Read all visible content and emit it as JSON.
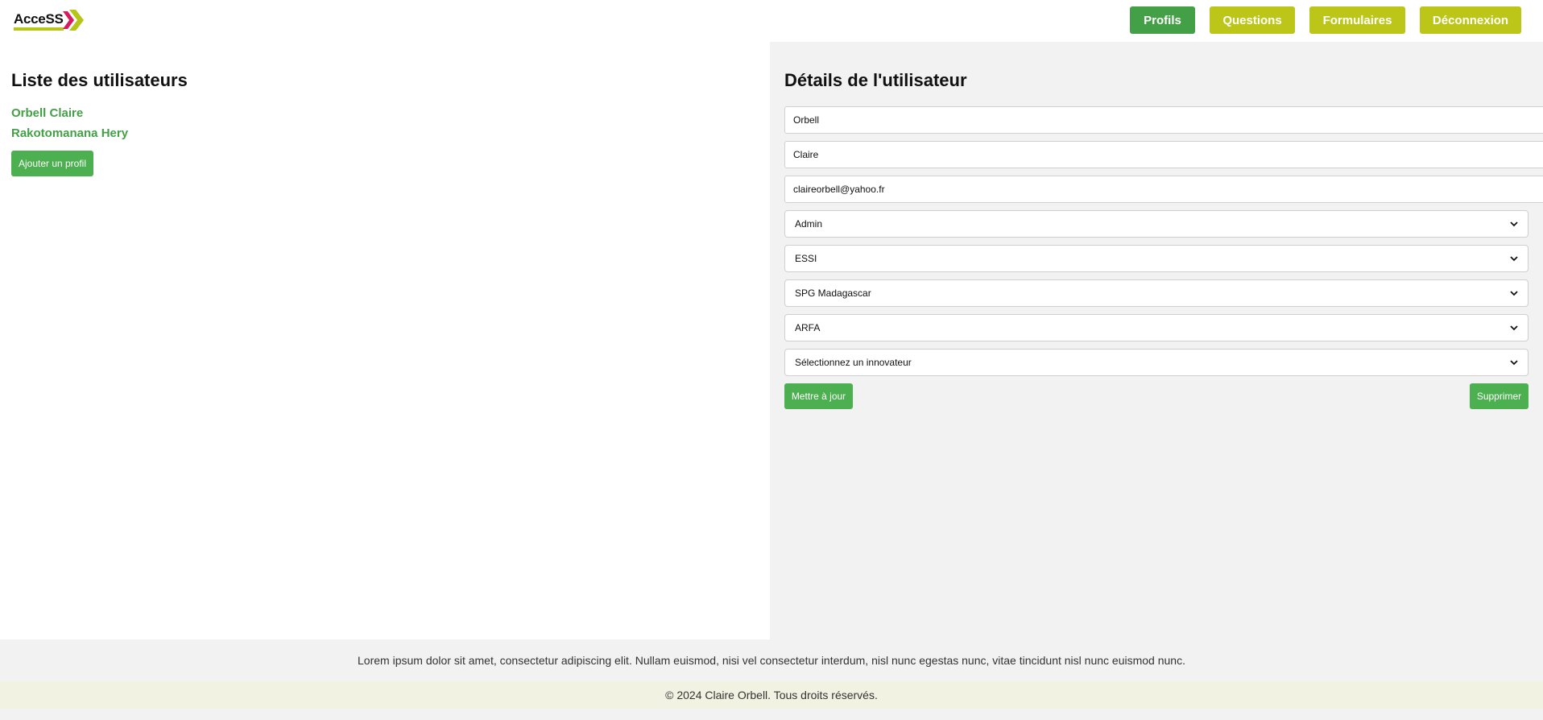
{
  "header": {
    "logo_text": "AcceSS",
    "nav": {
      "profils": "Profils",
      "questions": "Questions",
      "formulaires": "Formulaires",
      "deconnexion": "Déconnexion"
    }
  },
  "user_list": {
    "title": "Liste des utilisateurs",
    "users": [
      "Orbell Claire",
      "Rakotomanana Hery"
    ],
    "add_button": "Ajouter un profil"
  },
  "user_details": {
    "title": "Détails de l'utilisateur",
    "last_name": "Orbell",
    "first_name": "Claire",
    "email": "claireorbell@yahoo.fr",
    "role": "Admin",
    "school": "ESSI",
    "organization": "SPG Madagascar",
    "program": "ARFA",
    "innovator_placeholder": "Sélectionnez un innovateur",
    "update_button": "Mettre à jour",
    "delete_button": "Supprimer"
  },
  "footer": {
    "text": "Lorem ipsum dolor sit amet, consectetur adipiscing elit. Nullam euismod, nisi vel consectetur interdum, nisl nunc egestas nunc, vitae tincidunt nisl nunc euismod nunc.",
    "copyright": "© 2024 Claire Orbell. Tous droits réservés."
  },
  "colors": {
    "brand_green": "#4caf50",
    "active_nav": "#43a047",
    "lime_nav": "#bcc619"
  }
}
